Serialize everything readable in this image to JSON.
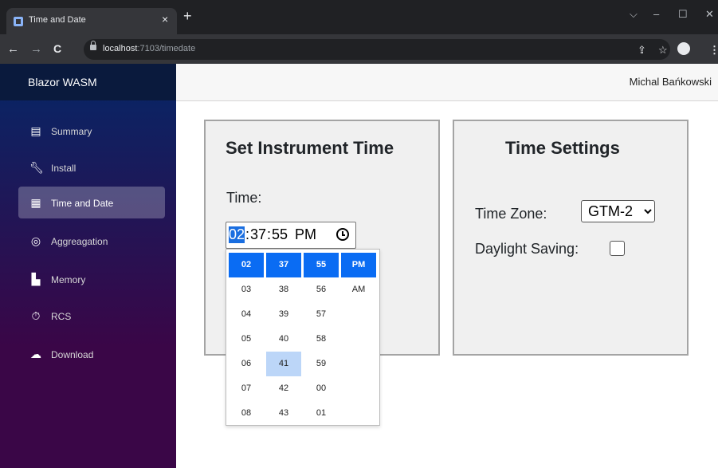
{
  "browser": {
    "tab_title": "Time and Date",
    "tab_close": "×",
    "new_tab": "+",
    "url_host": "localhost",
    "url_path": ":7103/timedate",
    "back": "←",
    "forward": "→",
    "reload": "C",
    "icons": [
      "share-icon",
      "star-icon",
      "profile-icon",
      "menu-icon"
    ]
  },
  "app": {
    "brand": "Blazor WASM",
    "user": "Michal Bańkowski",
    "nav": [
      {
        "label": "Summary",
        "icon": "calendar-icon",
        "active": false
      },
      {
        "label": "Install",
        "icon": "wrench-icon",
        "active": false
      },
      {
        "label": "Time and Date",
        "icon": "calculator-icon",
        "active": true
      },
      {
        "label": "Aggreagation",
        "icon": "dashboard-icon",
        "active": false
      },
      {
        "label": "Memory",
        "icon": "file-icon",
        "active": false
      },
      {
        "label": "RCS",
        "icon": "stopwatch-icon",
        "active": false
      },
      {
        "label": "Download",
        "icon": "cloud-download-icon",
        "active": false
      }
    ]
  },
  "instrument_time": {
    "title": "Set Instrument Time",
    "time_label": "Time:",
    "hour": "02",
    "minute": "37",
    "second": "55",
    "ampm": "PM",
    "picker": {
      "hours": [
        "02",
        "03",
        "04",
        "05",
        "06",
        "07",
        "08"
      ],
      "minutes": [
        "37",
        "38",
        "39",
        "40",
        "41",
        "42",
        "43"
      ],
      "seconds": [
        "55",
        "56",
        "57",
        "58",
        "59",
        "00",
        "01"
      ],
      "periods": [
        "PM",
        "AM"
      ]
    }
  },
  "time_settings": {
    "title": "Time Settings",
    "timezone_label": "Time Zone:",
    "timezone_value": "GTM-2",
    "daylight_label": "Daylight Saving:"
  }
}
